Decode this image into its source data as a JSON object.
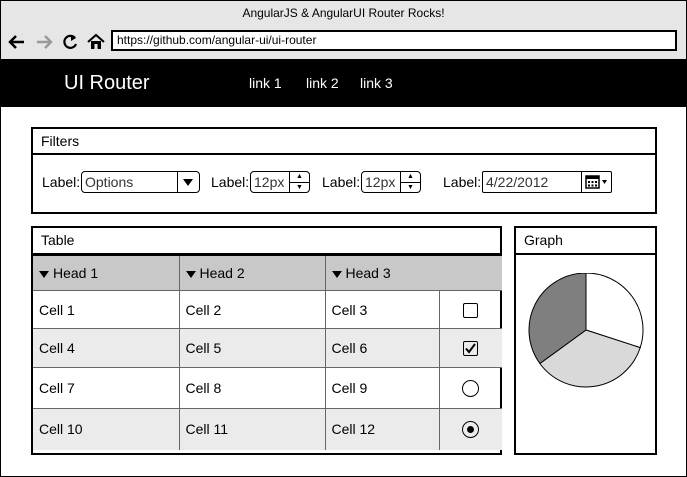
{
  "browser": {
    "title": "AngularJS & AngularUI Router Rocks!",
    "url": "https://github.com/angular-ui/ui-router",
    "icons": [
      "back-icon",
      "forward-icon",
      "reload-icon",
      "home-icon"
    ]
  },
  "header": {
    "brand": "UI Router",
    "links": [
      "link 1",
      "link 2",
      "link 3"
    ]
  },
  "filters": {
    "title": "Filters",
    "label": "Label:",
    "select_value": "Options",
    "stepper1_value": "12px",
    "stepper2_value": "12px",
    "date_value": "4/22/2012"
  },
  "table": {
    "title": "Table",
    "headers": [
      "Head 1",
      "Head 2",
      "Head 3"
    ],
    "rows": [
      {
        "cells": [
          "Cell 1",
          "Cell 2",
          "Cell 3"
        ],
        "control": "checkbox",
        "checked": false
      },
      {
        "cells": [
          "Cell 4",
          "Cell 5",
          "Cell 6"
        ],
        "control": "checkbox",
        "checked": true
      },
      {
        "cells": [
          "Cell 7",
          "Cell 8",
          "Cell 9"
        ],
        "control": "radio",
        "checked": false
      },
      {
        "cells": [
          "Cell 10",
          "Cell 11",
          "Cell 12"
        ],
        "control": "radio",
        "checked": true
      }
    ]
  },
  "graph": {
    "title": "Graph",
    "chart_data": {
      "type": "pie",
      "values": [
        30,
        35,
        35
      ],
      "colors": [
        "#ffffff",
        "#d9d9d9",
        "#7f7f7f"
      ]
    }
  }
}
